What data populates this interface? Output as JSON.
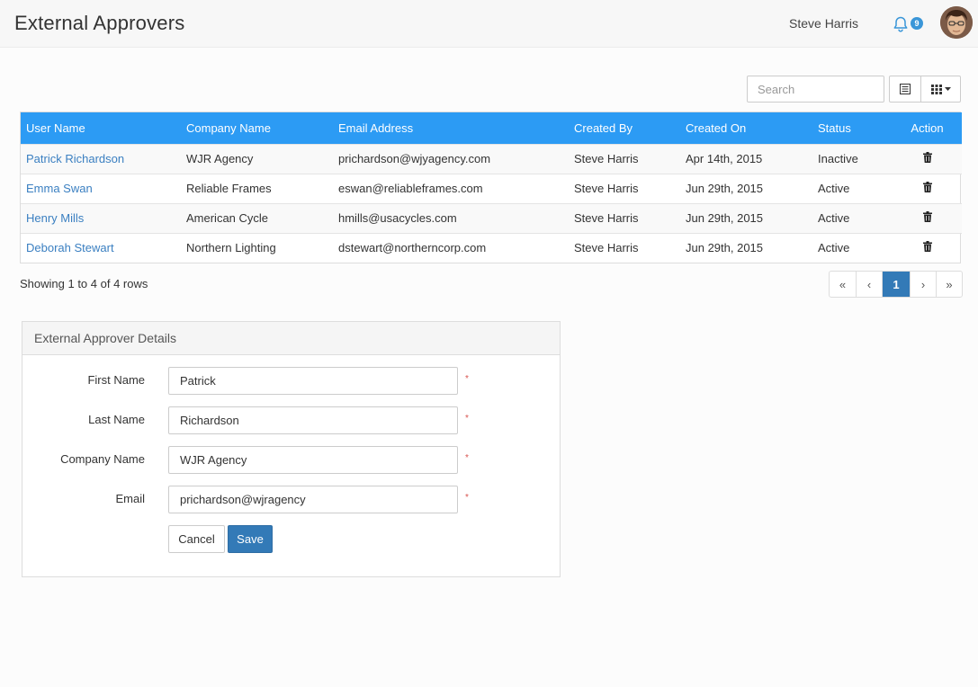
{
  "header": {
    "title": "External Approvers",
    "user_name": "Steve Harris",
    "notification_count": "9"
  },
  "toolbar": {
    "search_placeholder": "Search"
  },
  "table": {
    "columns": [
      "User Name",
      "Company Name",
      "Email Address",
      "Created By",
      "Created On",
      "Status",
      "Action"
    ],
    "rows": [
      {
        "user": "Patrick Richardson",
        "company": "WJR Agency",
        "email": "prichardson@wjyagency.com",
        "created_by": "Steve Harris",
        "created_on": "Apr 14th, 2015",
        "status": "Inactive"
      },
      {
        "user": "Emma Swan",
        "company": "Reliable Frames",
        "email": "eswan@reliableframes.com",
        "created_by": "Steve Harris",
        "created_on": "Jun 29th, 2015",
        "status": "Active"
      },
      {
        "user": "Henry Mills",
        "company": "American Cycle",
        "email": "hmills@usacycles.com",
        "created_by": "Steve Harris",
        "created_on": "Jun 29th, 2015",
        "status": "Active"
      },
      {
        "user": "Deborah Stewart",
        "company": "Northern Lighting",
        "email": "dstewart@northerncorp.com",
        "created_by": "Steve Harris",
        "created_on": "Jun 29th, 2015",
        "status": "Active"
      }
    ]
  },
  "footer": {
    "showing": "Showing 1 to 4 of 4 rows",
    "pages": [
      "«",
      "‹",
      "1",
      "›",
      "»"
    ],
    "active_page": "1"
  },
  "form": {
    "title": "External Approver Details",
    "first_name_label": "First Name",
    "first_name_value": "Patrick",
    "last_name_label": "Last Name",
    "last_name_value": "Richardson",
    "company_label": "Company Name",
    "company_value": "WJR Agency",
    "email_label": "Email",
    "email_value": "prichardson@wjragency",
    "required_mark": "*",
    "cancel_label": "Cancel",
    "save_label": "Save"
  },
  "colors": {
    "table_header": "#2c9bf4",
    "link": "#3a7fc1",
    "primary": "#337ab7",
    "required": "#d9534f"
  }
}
